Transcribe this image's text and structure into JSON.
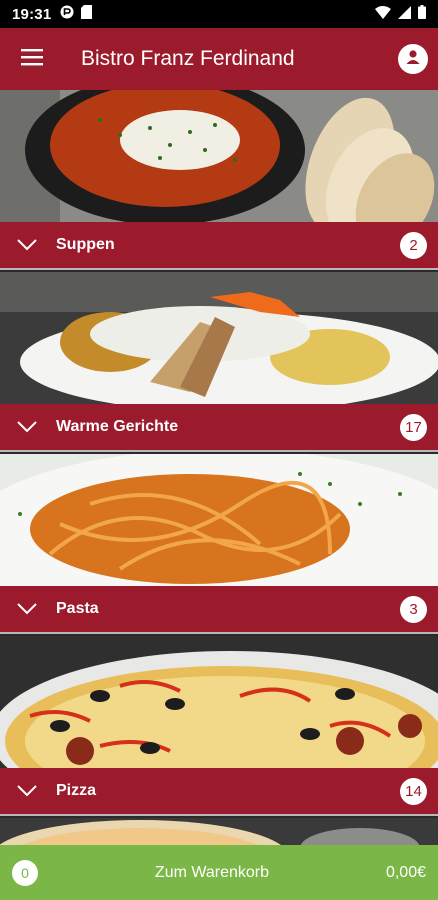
{
  "status_bar": {
    "time": "19:31",
    "icons": [
      "app-notification-icon",
      "sd-card-icon",
      "wifi-icon",
      "signal-icon",
      "battery-icon"
    ]
  },
  "app_bar": {
    "title": "Bistro Franz Ferdinand",
    "menu_icon": "hamburger-menu-icon",
    "profile_icon": "account-icon"
  },
  "categories": [
    {
      "title": "Suppen",
      "count": "2",
      "image": "soup-image"
    },
    {
      "title": "Warme Gerichte",
      "count": "17",
      "image": "warm-dish-image"
    },
    {
      "title": "Pasta",
      "count": "3",
      "image": "pasta-image"
    },
    {
      "title": "Pizza",
      "count": "14",
      "image": "pizza-image"
    }
  ],
  "cart": {
    "count": "0",
    "label": "Zum Warenkorb",
    "total": "0,00€"
  },
  "colors": {
    "primary": "#9b1b2d",
    "cart_green": "#7ab746",
    "badge_bg": "#ffffff"
  }
}
